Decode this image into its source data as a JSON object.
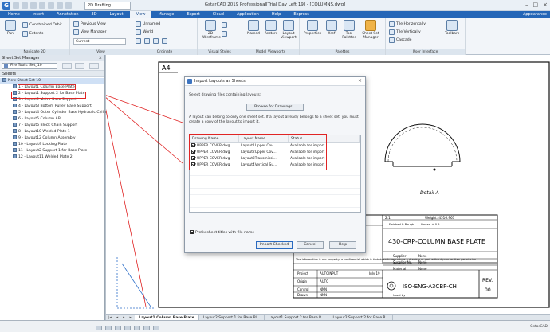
{
  "titlebar": {
    "workspace": "2D Drafting",
    "title": "GstarCAD 2019 Professional[Trial Day Left 19] - [COLUMNS.dwg]"
  },
  "menu": {
    "items": [
      "Home",
      "Insert",
      "Annotation",
      "3D",
      "Layout",
      "View",
      "Manage",
      "Export",
      "Cloud",
      "Application",
      "Help",
      "Express"
    ],
    "active": "View",
    "appearance": "Appearance"
  },
  "ribbon": {
    "navigate": {
      "pan": "Pan",
      "orbit": "Constrained Orbit",
      "extents": "Extents",
      "label": "Navigate 2D"
    },
    "view": {
      "previous": "Previous View",
      "manager": "View Manager",
      "current": "Current",
      "label": "View"
    },
    "ordinate": {
      "unnamed": "Unnamed",
      "world": "World",
      "label": "Ordinate"
    },
    "visual": {
      "wireframe": "2D Wireframe",
      "label": "Visual Styles"
    },
    "viewports": {
      "named": "Named",
      "restore": "Restore",
      "layout": "Layout Viewport",
      "label": "Model Viewports"
    },
    "palettes": {
      "properties": "Properties",
      "xref": "Xref",
      "tool": "Tool Palettes",
      "sheetset": "Sheet Set Manager",
      "label": "Palettes"
    },
    "ui": {
      "horizontal": "Tile Horizontally",
      "vertical": "Tile Vertically",
      "cascade": "Cascade",
      "toolbars": "Toolbars",
      "label": "User Interface"
    }
  },
  "panel": {
    "title": "Sheet Set Manager",
    "combo": "Fire Tools: Set_10",
    "section": "Sheets",
    "root": "New Sheet Set 10",
    "sheets": [
      "1 - Layout1 Column Base Plate",
      "2 - Layout1 Support 2 for Base Plate",
      "3 - Layout2 Motor Base Support",
      "4 - Layout3 Bottom Pulley Base Support",
      "5 - Layout4 Outer Cylinder Base Hydraulic Cylinder",
      "6 - Layout5 Column AB",
      "7 - Layout6 Block Chain Support",
      "8 - Layout10 Welded Plate 1",
      "9 - Layout12 Column Assembly",
      "10 - Layout9 Locking Plate",
      "11 - Layout2 Support 1 for Base Plate",
      "12 - Layout11 Welded Plate 2"
    ]
  },
  "dialog": {
    "title": "Import Layouts as Sheets",
    "select_label": "Select drawing files containing layouts:",
    "browse": "Browse for Drawings...",
    "info": "A layout can belong to only one sheet set. If a layout already belongs to a sheet set, you must create a copy of the layout to import it.",
    "columns": [
      "Drawing Name",
      "Layout Name",
      "Status"
    ],
    "rows": [
      {
        "drawing": "UPPER COVER.dwg",
        "layout": "Layout1Upper Cov...",
        "status": "Available for import"
      },
      {
        "drawing": "UPPER COVER.dwg",
        "layout": "Layout2Upper Cov...",
        "status": "Available for import"
      },
      {
        "drawing": "UPPER COVER.dwg",
        "layout": "Layout3Transmissi...",
        "status": "Available for import"
      },
      {
        "drawing": "UPPER COVER.dwg",
        "layout": "Layout4Vertical Su...",
        "status": "Available for import"
      }
    ],
    "prefix": "Prefix sheet titles with file name",
    "buttons": {
      "ok": "Import Checked",
      "cancel": "Cancel",
      "help": "Help"
    }
  },
  "drawing": {
    "sheet_size": "A4",
    "detail_label": "Detail A",
    "title": "430-CRP-COLUMN BASE PLATE",
    "drawing_no": "ISO-ENG-A3CBP-CH",
    "rev_label": "REV.",
    "rev": "00",
    "scale": "2:1",
    "weight": "Weight: 4516.963",
    "date": "July 19",
    "supplier_label": "Supplier",
    "supplier": "None",
    "supplier_no_label": "Supplier No.",
    "supplier_no": "None",
    "material_label": "Material",
    "material": "None",
    "project_label": "Project",
    "project": "AUTOINPUT",
    "origin_label": "Origin",
    "origin": "AUTO",
    "control_label": "Control",
    "control": "NNN",
    "drawn_label": "Drawn",
    "drawn": "NNN",
    "used_label": "Used by",
    "notice": "The information is our property, a confidential which is forbidden to reproduce a drawing or part without prior written permission.",
    "finish": "Finished & Rough",
    "tolerance": "Linear: +-0.5",
    "doc_no_label": "Doc. No"
  },
  "tabs": {
    "items": [
      "Layout1 Column Base Plate",
      "Layout2 Support 1 for Base Pl...",
      "Layout1 Support 2 for Base P...",
      "Layout2 Support 2 for Base P..."
    ]
  },
  "statusbar": {
    "right": "GstarCAD"
  }
}
